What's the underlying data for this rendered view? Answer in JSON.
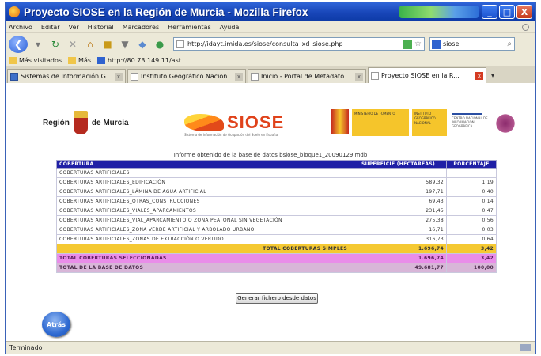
{
  "window": {
    "title": "Proyecto SIOSE en la Región de Murcia - Mozilla Firefox",
    "controls": [
      "_",
      "□",
      "X"
    ]
  },
  "menu": [
    "Archivo",
    "Editar",
    "Ver",
    "Historial",
    "Marcadores",
    "Herramientas",
    "Ayuda"
  ],
  "nav": {
    "url": "http://idayt.imida.es/siose/consulta_xd_siose.php",
    "search_value": "siose"
  },
  "bookmarks": [
    "Más visitados",
    "Más",
    "http://80.73.149.11/ast..."
  ],
  "tabs": [
    {
      "label": "Sistemas de Información G...",
      "active": false
    },
    {
      "label": "Instituto Geográfico Nacion...",
      "active": false
    },
    {
      "label": "Inicio - Portal de Metadato...",
      "active": false
    },
    {
      "label": "Proyecto SIOSE en la R...",
      "active": true
    }
  ],
  "logos": {
    "region": "Región",
    "murcia": "de Murcia",
    "siose": "SIOSE",
    "siose_sub": "Sistema de Información de Ocupación del Suelo en España",
    "ministry": "MINISTERIO DE FOMENTO",
    "ign": "INSTITUTO GEOGRÁFICO NACIONAL",
    "cnig": "CENTRO NACIONAL DE INFORMACIÓN GEOGRÁFICA"
  },
  "report": {
    "title": "Informe obtenido de la base de datos bsiose_bloque1_20090129.mdb",
    "headers": [
      "COBERTURA",
      "SUPERFICIE (HECTÁREAS)",
      "PORCENTAJE"
    ],
    "rows": [
      {
        "cobertura": "COBERTURAS ARTIFICIALES",
        "superficie": "",
        "porcentaje": ""
      },
      {
        "cobertura": "COBERTURAS ARTIFICIALES_EDIFICACIÓN",
        "superficie": "589,32",
        "porcentaje": "1,19"
      },
      {
        "cobertura": "COBERTURAS ARTIFICIALES_LÁMINA DE AGUA ARTIFICIAL",
        "superficie": "197,71",
        "porcentaje": "0,40"
      },
      {
        "cobertura": "COBERTURAS ARTIFICIALES_OTRAS_CONSTRUCCIONES",
        "superficie": "69,43",
        "porcentaje": "0,14"
      },
      {
        "cobertura": "COBERTURAS ARTIFICIALES_VIALES_APARCAMIENTOS",
        "superficie": "231,45",
        "porcentaje": "0,47"
      },
      {
        "cobertura": "COBERTURAS ARTIFICIALES_VIAL_APARCAMIENTO O ZONA PEATONAL SIN VEGETACIÓN",
        "superficie": "275,38",
        "porcentaje": "0,56"
      },
      {
        "cobertura": "COBERTURAS ARTIFICIALES_ZONA VERDE ARTIFICIAL Y ARBOLADO URBANO",
        "superficie": "16,71",
        "porcentaje": "0,03"
      },
      {
        "cobertura": "COBERTURAS ARTIFICIALES_ZONAS DE EXTRACCIÓN O VERTIDO",
        "superficie": "316,73",
        "porcentaje": "0,64"
      }
    ],
    "total_selected": {
      "label": "TOTAL COBERTURAS SIMPLES",
      "superficie": "1.696,74",
      "porcentaje": "3,42"
    },
    "total_coverages": {
      "label": "TOTAL COBERTURAS SELECCIONADAS",
      "superficie": "1.696,74",
      "porcentaje": "3,42"
    },
    "total_db": {
      "label": "TOTAL DE LA BASE DE DATOS",
      "superficie": "49.681,77",
      "porcentaje": "100,00"
    },
    "button": "Generar fichero desde datos"
  },
  "back_button": "Atrás",
  "status": "Terminado"
}
